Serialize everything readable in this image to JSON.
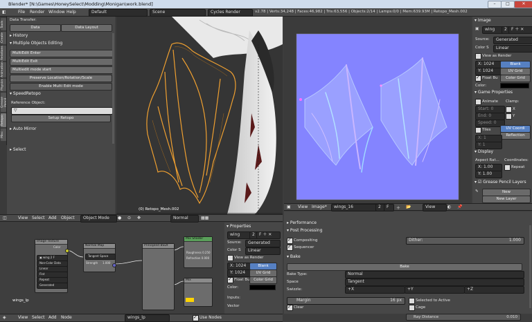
{
  "window": {
    "title": "Blender* [N:\\Games\\HoneySelect\\Modding\\Monigan\\work.blend]",
    "minimize": "–",
    "maximize": "□",
    "close": "✕"
  },
  "menubar": {
    "items": [
      "File",
      "Render",
      "Window",
      "Help"
    ],
    "layout": "Default",
    "scene": "Scene",
    "engine": "Cycles Render",
    "stats": "v2.78 | Verts:34,248 | Faces:46,982 | Tris:63,556 | Objects:2/14 | Lamps:0/0 | Mem:639.93M | Retopo_Mesh.002"
  },
  "tabs": [
    "Tools",
    "Create",
    "Relations",
    "Animation",
    "Physics",
    "Grease Pencil",
    "Retopo",
    "Misc"
  ],
  "toolshelf": {
    "data_transfer_header": "Data Transfer:",
    "data_btn": "Data",
    "data_layout_btn": "Data Layout",
    "history_header": "History",
    "multi_edit_header": "Multiple Objects Editing",
    "multiedit_enter": "MultiEdit Enter",
    "multiedit_exit": "MultiEdit Exit",
    "multiedit_start": "Multiedit mode start",
    "preserve": "Preserve Location/Rotation/Scale",
    "enable_multi": "Enable Multi Edit mode",
    "speedretopo_header": "SpeedRetopo",
    "reference_object": "Reference Object:",
    "setup_retopo": "Setup Retopo",
    "auto_mirror_header": "Auto Mirror",
    "select_header": "Select"
  },
  "viewport": {
    "object_label": "(0) Retopo_Mesh.002",
    "header": {
      "view": "View",
      "select": "Select",
      "add": "Add",
      "object": "Object",
      "mode": "Object Mode",
      "orientation": "Normal"
    }
  },
  "image_editor": {
    "header": {
      "view": "View",
      "image": "Image*",
      "name": "wings_16",
      "users": "2",
      "f": "F",
      "viewmode": "View"
    }
  },
  "image_props": {
    "image_header": "Image",
    "image_name": "wing",
    "image_users": "2",
    "source_label": "Source:",
    "source_value": "Generated",
    "color_label": "Color S",
    "color_value": "Linear",
    "view_as_render": "View as Render",
    "x_value": "X: 1024",
    "y_value": "Y: 1024",
    "float_buffer": "Float Bu",
    "gen_blank": "Blank",
    "gen_uvgrid": "UV Grid",
    "gen_colorgrid": "Color Grid",
    "color_field_label": "Color:",
    "game_props_header": "Game Properties",
    "animate": "Animate",
    "clamp": "Clamp:",
    "start": "Start: 0",
    "end": "End: 0",
    "speed": "Speed: 0",
    "clamp_x": "X",
    "clamp_y": "Y",
    "tiles": "Tiles",
    "tiles_x": "X: 1",
    "tiles_y": "Y: 1",
    "uv_coordi": "UV Coordi",
    "reflection": "Reflection",
    "display_header": "Display",
    "aspect_ratio": "Aspect Rat...",
    "coordinates": "Coordinates:",
    "aspect_x": "X: 1.00",
    "aspect_y": "Y: 1.00",
    "repeat": "Repeat",
    "gpencil_header": "Grease Pencil Layers",
    "new": "New",
    "new_layer": "New Layer"
  },
  "node_editor": {
    "header": {
      "view": "View",
      "select": "Select",
      "add": "Add",
      "node": "Node",
      "material": "wings_lp",
      "use_nodes": "Use Nodes"
    },
    "material_label": "wings_lp",
    "nodes": {
      "image_texture": "Image Texture",
      "normal_map": "Normal Map",
      "tangent_space": "Tangent Space",
      "principled": "Principled BSDF",
      "mix_shader": "Mix Shader",
      "mix": "Mix",
      "strength": "Strength",
      "strength_value": "1.000",
      "roughness": "Roughness 0.250",
      "refraction": "Refraction 0.000",
      "color": "Color",
      "vector": "Vector",
      "non_color": "Non-Color Data",
      "linear": "Linear",
      "flat": "Flat",
      "repeat": "Repeat",
      "generated": "Generated"
    }
  },
  "node_props": {
    "header": "Properties",
    "image_name": "wing",
    "users": "2",
    "source_label": "Source:",
    "source_value": "Generated",
    "color_label": "Color S",
    "color_value": "Linear",
    "view_as_render": "View as Render",
    "x_value": "X: 1024",
    "y_value": "Y: 1024",
    "float_buffer": "Float Bu",
    "gen_blank": "Blank",
    "gen_uvgrid": "UV Grid",
    "gen_colorgrid": "Color Grid",
    "color_label2": "Color:",
    "inputs_label": "Inputs:",
    "vector_label": "Vector"
  },
  "render_props": {
    "performance": "Performance",
    "post_processing": "Post Processing",
    "compositing": "Compositing",
    "sequencer": "Sequencer",
    "dither_label": "Dither:",
    "dither_value": "1.000",
    "bake_header": "Bake",
    "bake_btn": "Bake",
    "bake_type_label": "Bake Type:",
    "bake_type_value": "Normal",
    "space_label": "Space",
    "space_value": "Tangent",
    "swizzle_label": "Swizzle:",
    "swz_x": "+X",
    "swz_y": "+Y",
    "swz_z": "+Z",
    "margin_label": "Margin",
    "margin_value": "16 px",
    "clear": "Clear",
    "selected_to_active": "Selected to Active",
    "cage": "Cage",
    "ray_distance_label": "Ray Distance",
    "ray_distance_value": "0.010"
  },
  "colors": {
    "accent": "#5680c2",
    "normal_map_bg": "#8080ff",
    "wire": "#f0a030"
  }
}
